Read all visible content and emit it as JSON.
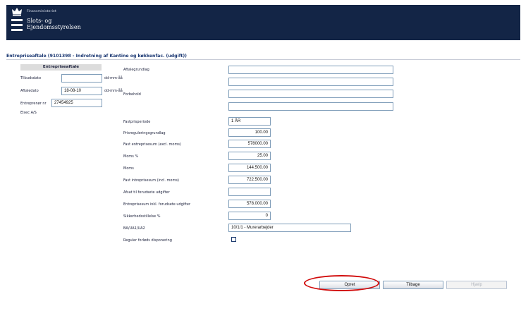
{
  "header": {
    "ministry": "Finansministeriet",
    "agency_line1": "Slots- og",
    "agency_line2": "Ejendomsstyrelsen"
  },
  "page_title": "Entrepriseaftale (9101398 - Indretning af Kantine og køkkenfac. (udgift))",
  "left": {
    "section_title": "Entrepriseaftale",
    "tilbudsdato_label": "Tilbudsdato",
    "tilbudsdato_value": "",
    "tilbudsdato_format": "dd-mm-åå",
    "aftaledato_label": "Aftaledato",
    "aftaledato_value": "18-08-10",
    "aftaledato_format": "dd-mm-åå",
    "entreprenor_label": "Entreprenør nr",
    "entreprenor_value": "27454925",
    "company": "Elsec A/S"
  },
  "right": {
    "aftalegrundlag_label": "Aftalegrundlag",
    "aftalegrundlag_1": "",
    "aftalegrundlag_2": "",
    "forbehold_label": "Forbehold",
    "forbehold_1": "",
    "forbehold_2": "",
    "fastprisperiode_label": "Fastprisperiode",
    "fastprisperiode_value": "1 ÅR",
    "prisregulering_label": "Prisreguleringsgrundlag",
    "prisregulering_value": "100.00",
    "fast_entreprisesum_label": "Fast entreprisesum (excl. moms)",
    "fast_entreprisesum_value": "578000.00",
    "moms_pct_label": "Moms %",
    "moms_pct_value": "25.00",
    "moms_label": "Moms",
    "moms_value": "144.500.00",
    "fast_incl_label": "Fast intreprisesum (incl. moms)",
    "fast_incl_value": "722.500.00",
    "afsat_label": "Afsat til forudsete udgifter",
    "afsat_value": "",
    "inkl_forudsete_label": "Entreprisesum inkl. forudsete udgifter",
    "inkl_forudsete_value": "578.000.00",
    "sikkerhed_label": "Sikkerhedsstillelse %",
    "sikkerhed_value": "0",
    "ba_label": "BA/UA1/UA2",
    "ba_value": "10/1/1 - Murerarbejder",
    "reguler_label": "Reguler forløds disponering"
  },
  "buttons": {
    "opret": "Opret",
    "tilbage": "Tilbage",
    "hjaelp": "Hjælp"
  },
  "colors": {
    "header_bg": "#132546",
    "title_blue": "#1a3772",
    "highlight_ring": "#d10b0b"
  }
}
